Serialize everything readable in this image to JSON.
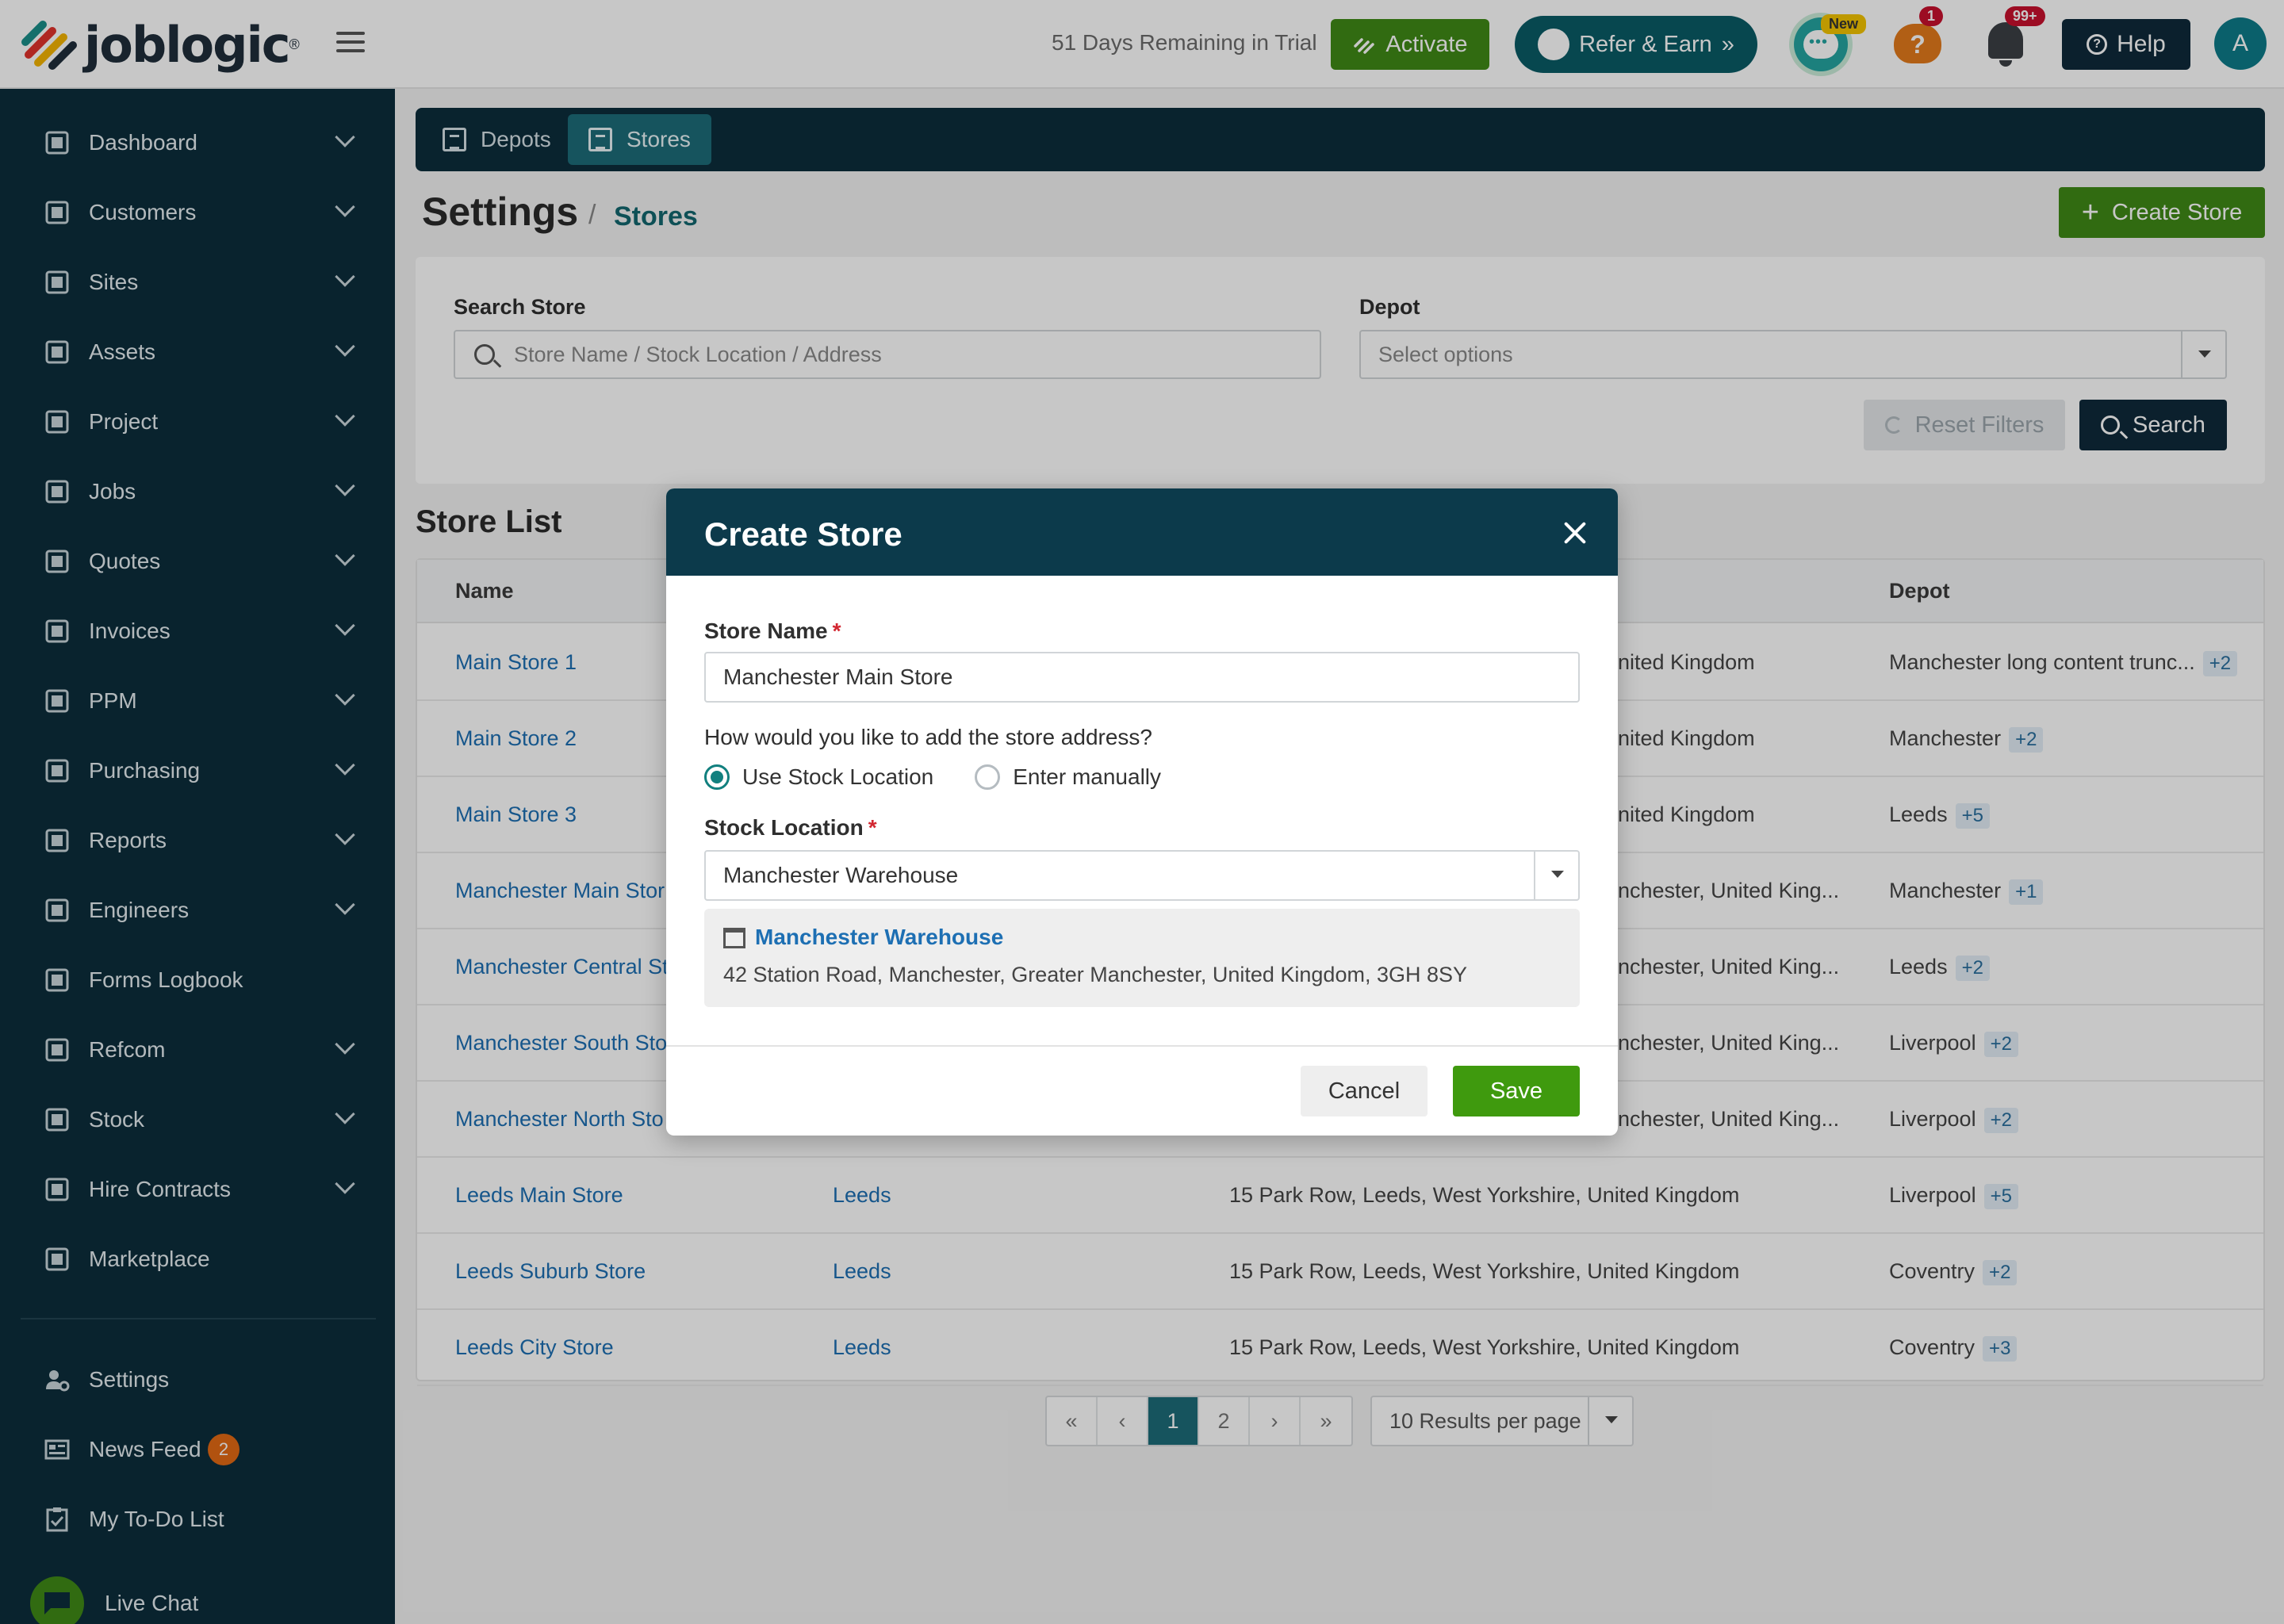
{
  "header": {
    "logo_text": "joblogic",
    "logo_reg": "®",
    "trial_text": "51 Days Remaining in Trial",
    "activate_label": "Activate",
    "refer_label": "Refer & Earn",
    "refer_chevrons": "»",
    "new_badge": "New",
    "question_badge": "1",
    "question_mark": "?",
    "bell_badge": "99+",
    "help_label": "Help",
    "avatar_initial": "A"
  },
  "sidebar": {
    "items": [
      {
        "label": "Dashboard",
        "icon": "dashboard-icon",
        "chevron": true
      },
      {
        "label": "Customers",
        "icon": "person-icon",
        "chevron": true
      },
      {
        "label": "Sites",
        "icon": "building-icon",
        "chevron": true
      },
      {
        "label": "Assets",
        "icon": "asset-icon",
        "chevron": true
      },
      {
        "label": "Project",
        "icon": "project-icon",
        "chevron": true
      },
      {
        "label": "Jobs",
        "icon": "wrench-icon",
        "chevron": true
      },
      {
        "label": "Quotes",
        "icon": "clipboard-icon",
        "chevron": true
      },
      {
        "label": "Invoices",
        "icon": "card-icon",
        "chevron": true
      },
      {
        "label": "PPM",
        "icon": "calendar-check-icon",
        "chevron": true
      },
      {
        "label": "Purchasing",
        "icon": "document-icon",
        "chevron": true
      },
      {
        "label": "Reports",
        "icon": "pie-chart-icon",
        "chevron": true
      },
      {
        "label": "Engineers",
        "icon": "people-icon",
        "chevron": true
      },
      {
        "label": "Forms Logbook",
        "icon": "book-icon",
        "chevron": false
      },
      {
        "label": "Refcom",
        "icon": "cylinder-icon",
        "chevron": true
      },
      {
        "label": "Stock",
        "icon": "warehouse-icon",
        "chevron": true
      },
      {
        "label": "Hire Contracts",
        "icon": "contract-icon",
        "chevron": true
      },
      {
        "label": "Marketplace",
        "icon": "grid-icon",
        "chevron": false
      }
    ],
    "bottom": {
      "settings": "Settings",
      "news_feed": "News Feed",
      "news_badge": "2",
      "todo": "My To-Do List",
      "live_chat": "Live Chat"
    }
  },
  "tabs": [
    {
      "label": "Depots",
      "active": false
    },
    {
      "label": "Stores",
      "active": true
    }
  ],
  "page": {
    "title": "Settings",
    "breadcrumb_sep": "/",
    "breadcrumb": "Stores",
    "create_label": "Create Store"
  },
  "filters": {
    "search_label": "Search Store",
    "search_placeholder": "Store Name / Stock Location / Address",
    "depot_label": "Depot",
    "depot_placeholder": "Select options",
    "reset_label": "Reset Filters",
    "search_button": "Search"
  },
  "list": {
    "title": "Store List",
    "headers": [
      "Name",
      "Depot"
    ],
    "rows": [
      {
        "name": "Main Store 1",
        "loc": "",
        "addr": "nited Kingdom",
        "depot": "Manchester long content trunc...",
        "more": "+2"
      },
      {
        "name": "Main Store 2",
        "loc": "",
        "addr": "nited Kingdom",
        "depot": "Manchester",
        "more": "+2"
      },
      {
        "name": "Main Store 3",
        "loc": "",
        "addr": "nited Kingdom",
        "depot": "Leeds",
        "more": "+5"
      },
      {
        "name": "Manchester Main Stor",
        "loc": "",
        "addr": "nchester, United King...",
        "depot": "Manchester",
        "more": "+1"
      },
      {
        "name": "Manchester Central St",
        "loc": "",
        "addr": "nchester, United King...",
        "depot": "Leeds",
        "more": "+2"
      },
      {
        "name": "Manchester South Sto",
        "loc": "",
        "addr": "nchester, United King...",
        "depot": "Liverpool",
        "more": "+2"
      },
      {
        "name": "Manchester North Sto",
        "loc": "",
        "addr": "nchester, United King...",
        "depot": "Liverpool",
        "more": "+2"
      },
      {
        "name": "Leeds Main Store",
        "loc": "Leeds",
        "addr": "15 Park Row, Leeds, West Yorkshire, United Kingdom",
        "depot": "Liverpool",
        "more": "+5"
      },
      {
        "name": "Leeds Suburb Store",
        "loc": "Leeds",
        "addr": "15 Park Row, Leeds, West Yorkshire, United Kingdom",
        "depot": "Coventry",
        "more": "+2"
      },
      {
        "name": "Leeds City Store",
        "loc": "Leeds",
        "addr": "15 Park Row, Leeds, West Yorkshire, United Kingdom",
        "depot": "Coventry",
        "more": "+3"
      }
    ]
  },
  "pagination": {
    "first": "«",
    "prev": "‹",
    "pages": [
      "1",
      "2"
    ],
    "current": "1",
    "next": "›",
    "last": "»",
    "per_page": "10 Results per page"
  },
  "modal": {
    "title": "Create Store",
    "store_name_label": "Store Name",
    "required_mark": "*",
    "store_name_value": "Manchester Main Store",
    "address_question": "How would you like to add the store address?",
    "option_stock": "Use Stock Location",
    "option_manual": "Enter manually",
    "selected_option": "stock",
    "stock_location_label": "Stock Location",
    "stock_location_value": "Manchester Warehouse",
    "location_card_name": "Manchester Warehouse",
    "location_card_address": "42 Station Road, Manchester, Greater Manchester, United Kingdom, 3GH 8SY",
    "cancel_label": "Cancel",
    "save_label": "Save"
  },
  "colors": {
    "sidebar_bg": "#0c2d3b",
    "accent_teal": "#1d6c79",
    "brand_green": "#3f8a17",
    "link_blue": "#1d6fb3",
    "required_red": "#d22630"
  }
}
